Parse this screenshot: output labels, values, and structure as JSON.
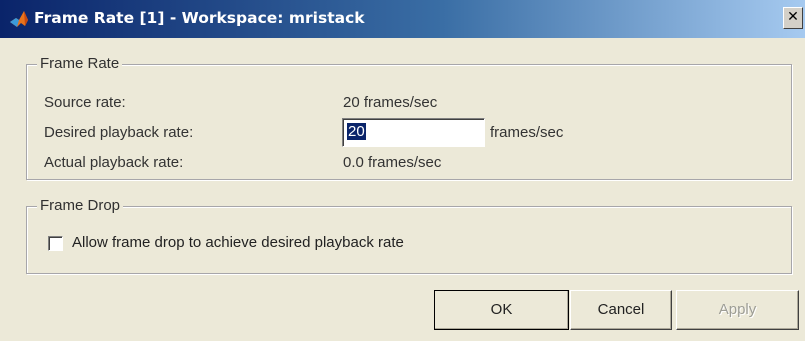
{
  "window": {
    "title": "Frame Rate [1] - Workspace: mristack",
    "close_glyph": "✕"
  },
  "frame_rate": {
    "legend": "Frame Rate",
    "source_label": "Source rate:",
    "source_value": "20 frames/sec",
    "desired_label": "Desired playback rate:",
    "desired_value": "20",
    "desired_unit": "frames/sec",
    "actual_label": "Actual playback rate:",
    "actual_value": "0.0 frames/sec"
  },
  "frame_drop": {
    "legend": "Frame Drop",
    "checkbox_label": "Allow frame drop to achieve desired playback rate",
    "checked": false
  },
  "buttons": {
    "ok": "OK",
    "cancel": "Cancel",
    "apply": "Apply"
  },
  "icons": {
    "title": "matlab-logo-icon",
    "close": "close-icon"
  }
}
